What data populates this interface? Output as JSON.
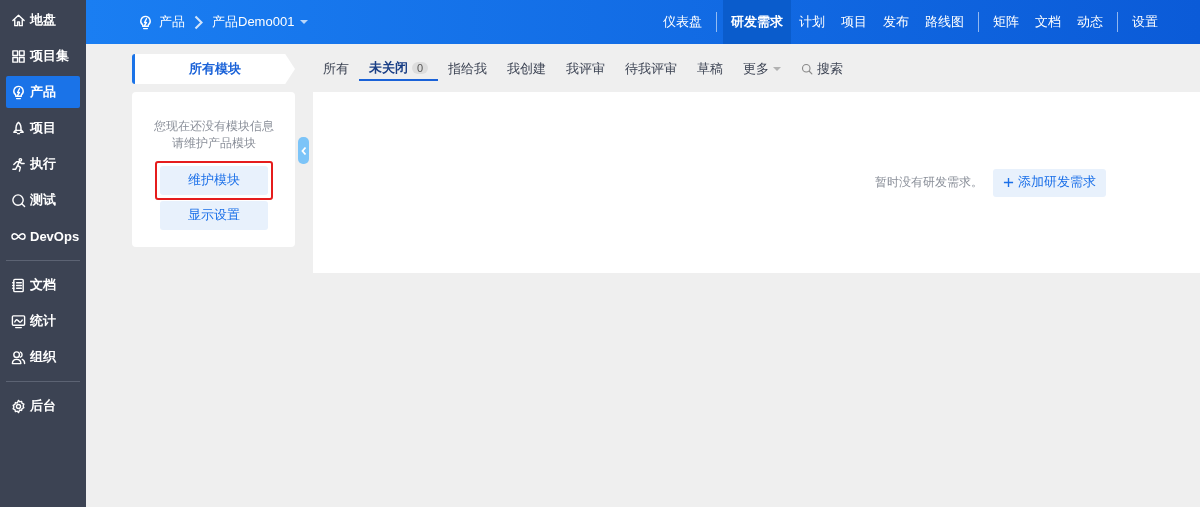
{
  "sidebar": {
    "groups": [
      [
        {
          "label": "地盘",
          "selected": false
        },
        {
          "label": "项目集",
          "selected": false
        },
        {
          "label": "产品",
          "selected": true
        },
        {
          "label": "项目",
          "selected": false
        },
        {
          "label": "执行",
          "selected": false
        },
        {
          "label": "测试",
          "selected": false
        },
        {
          "label": "DevOps",
          "selected": false
        }
      ],
      [
        {
          "label": "文档",
          "selected": false
        },
        {
          "label": "统计",
          "selected": false
        },
        {
          "label": "组织",
          "selected": false
        }
      ],
      [
        {
          "label": "后台",
          "selected": false
        }
      ]
    ]
  },
  "breadcrumb": {
    "root": "产品",
    "current": "产品Demo001"
  },
  "nav": {
    "groups": [
      [
        {
          "label": "仪表盘",
          "selected": false
        }
      ],
      [
        {
          "label": "研发需求",
          "selected": true
        },
        {
          "label": "计划",
          "selected": false
        },
        {
          "label": "项目",
          "selected": false
        },
        {
          "label": "发布",
          "selected": false
        },
        {
          "label": "路线图",
          "selected": false
        }
      ],
      [
        {
          "label": "矩阵",
          "selected": false
        },
        {
          "label": "文档",
          "selected": false
        },
        {
          "label": "动态",
          "selected": false
        }
      ],
      [
        {
          "label": "设置",
          "selected": false
        }
      ]
    ]
  },
  "module_panel": {
    "title": "所有模块",
    "message": [
      "您现在还没有模块信息",
      "请维护产品模块"
    ],
    "buttons": [
      {
        "label": "维护模块",
        "highlighted": true
      },
      {
        "label": "显示设置",
        "highlighted": false
      }
    ]
  },
  "filter_tabs": [
    {
      "kind": "tab",
      "label": "所有",
      "selected": false
    },
    {
      "kind": "tab",
      "label": "未关闭",
      "count": "0",
      "selected": true
    },
    {
      "kind": "tab",
      "label": "指给我",
      "selected": false
    },
    {
      "kind": "tab",
      "label": "我创建",
      "selected": false
    },
    {
      "kind": "tab",
      "label": "我评审",
      "selected": false
    },
    {
      "kind": "tab",
      "label": "待我评审",
      "selected": false
    },
    {
      "kind": "tab",
      "label": "草稿",
      "selected": false
    },
    {
      "kind": "dropdown",
      "label": "更多",
      "selected": false
    },
    {
      "kind": "search",
      "label": "搜索",
      "selected": false
    }
  ],
  "empty_state": {
    "message": "暂时没有研发需求。",
    "button": "添加研发需求"
  }
}
